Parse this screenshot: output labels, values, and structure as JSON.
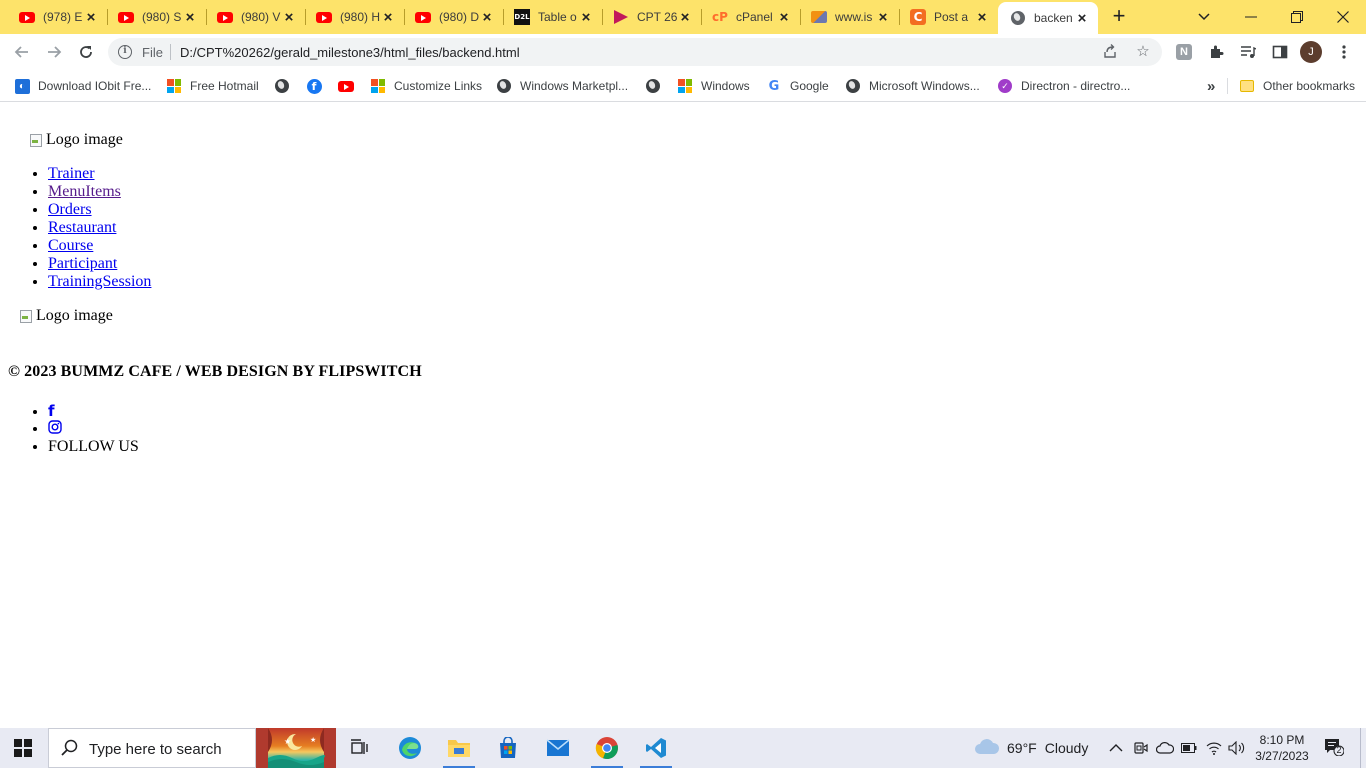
{
  "browser": {
    "tabs": [
      {
        "label": "(978) E",
        "icon": "youtube-icon",
        "active": false
      },
      {
        "label": "(980) S",
        "icon": "youtube-icon",
        "active": false
      },
      {
        "label": "(980) V",
        "icon": "youtube-icon",
        "active": false
      },
      {
        "label": "(980) H",
        "icon": "youtube-icon",
        "active": false
      },
      {
        "label": "(980) D",
        "icon": "youtube-icon",
        "active": false
      },
      {
        "label": "Table o",
        "icon": "d2l-icon",
        "active": false
      },
      {
        "label": "CPT 26",
        "icon": "cpt-icon",
        "active": false
      },
      {
        "label": "cPanel",
        "icon": "cpanel-icon",
        "active": false
      },
      {
        "label": "www.is",
        "icon": "phpmyadmin-icon",
        "active": false
      },
      {
        "label": "Post a",
        "icon": "c-icon",
        "active": false
      },
      {
        "label": "backen",
        "icon": "globe-icon",
        "active": true
      }
    ],
    "address": {
      "scheme_label": "File",
      "url": "D:/CPT%20262/gerald_milestone3/html_files/backend.html"
    },
    "profile_initial": "J",
    "bookmarks": [
      {
        "label": "Download IObit Fre...",
        "icon": "iobit-icon"
      },
      {
        "label": "Free Hotmail",
        "icon": "microsoft-icon"
      },
      {
        "label": "",
        "icon": "globe-icon"
      },
      {
        "label": "",
        "icon": "facebook-icon"
      },
      {
        "label": "",
        "icon": "youtube-icon"
      },
      {
        "label": "Customize Links",
        "icon": "microsoft-icon"
      },
      {
        "label": "Windows Marketpl...",
        "icon": "globe-icon"
      },
      {
        "label": "",
        "icon": "globe-icon"
      },
      {
        "label": "Windows",
        "icon": "microsoft-icon"
      },
      {
        "label": "Google",
        "icon": "google-icon"
      },
      {
        "label": "Microsoft Windows...",
        "icon": "globe-icon"
      },
      {
        "label": "Directron - directro...",
        "icon": "directron-icon"
      }
    ],
    "bookmarks_overflow": "»",
    "other_bookmarks": "Other bookmarks"
  },
  "page": {
    "logo_alt_top": "Logo image",
    "nav": [
      "Trainer",
      "MenuItems",
      "Orders",
      "Restaurant",
      "Course",
      "Participant",
      "TrainingSession"
    ],
    "logo_alt_footer": "Logo image",
    "footer_heading": "© 2023 BUMMZ CAFE / WEB DESIGN BY FLIPSWITCH",
    "social": {
      "facebook_glyph": "f",
      "follow_text": "FOLLOW US"
    }
  },
  "taskbar": {
    "search_placeholder": "Type here to search",
    "weather_temp": "69°F",
    "weather_desc": "Cloudy",
    "time": "8:10 PM",
    "date": "3/27/2023",
    "notification_count": "2"
  },
  "colors": {
    "tabstrip": "#fde36a",
    "link": "#0000ee",
    "visited_link": "#551a8b",
    "taskbar": "#e8eaf3"
  }
}
